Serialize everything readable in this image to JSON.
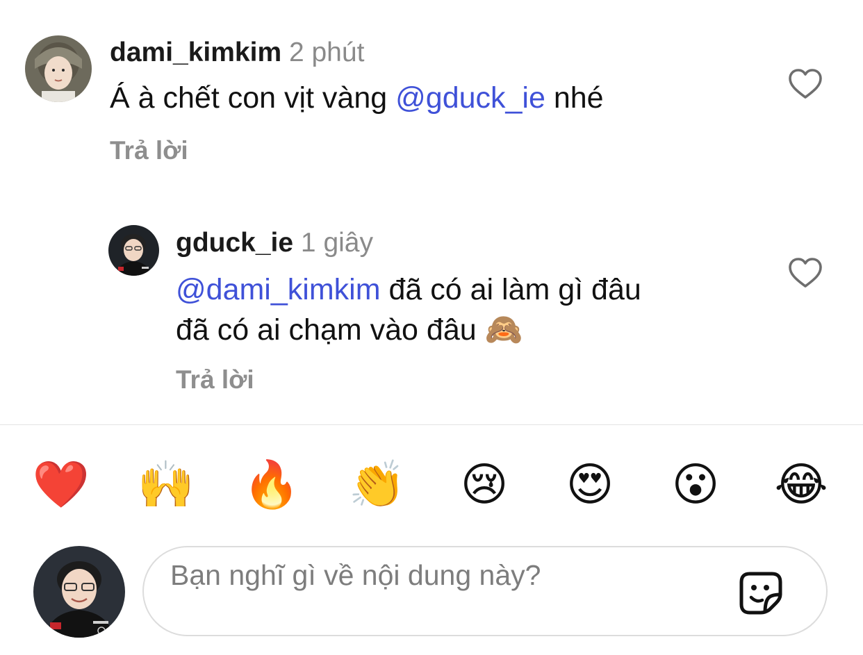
{
  "comments": [
    {
      "username": "dami_kimkim",
      "time": "2 phút",
      "text_before": "Á à chết con vịt vàng ",
      "mention": "@gduck_ie",
      "text_after": " nhé",
      "reply_label": "Trả lời",
      "like_icon": "heart-outline-icon"
    },
    {
      "username": "gduck_ie",
      "time": "1 giây",
      "mention": "@dami_kimkim",
      "line1_after": " đã có ai làm gì đâu",
      "line2": "đã có ai chạm vào đâu ",
      "emoji": "🙈",
      "reply_label": "Trả lời",
      "like_icon": "heart-outline-icon"
    }
  ],
  "reactions": [
    "❤️",
    "🙌",
    "🔥",
    "👏",
    "😢",
    "😍",
    "😮",
    "😂"
  ],
  "composer": {
    "placeholder": "Bạn nghĩ gì về nội dung này?",
    "sticker_icon": "sticker-icon"
  },
  "colors": {
    "mention": "#3f51d8",
    "secondary_text": "#8e8e8e",
    "divider": "#e3e3e3"
  }
}
